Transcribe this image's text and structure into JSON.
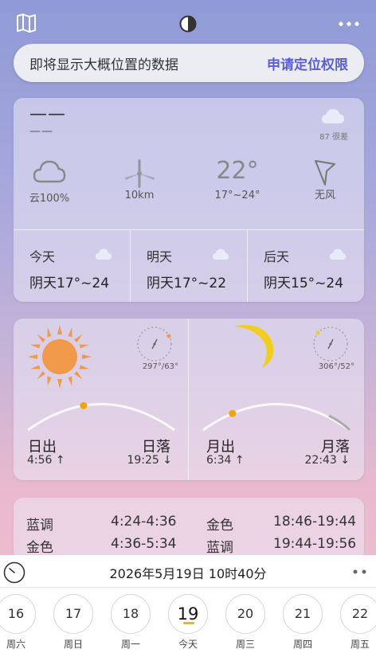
{
  "location_banner": {
    "message": "即将显示大概位置的数据",
    "action": "申请定位权限"
  },
  "current": {
    "location": "——",
    "sublocation": "——",
    "aqi_text": "87 很差",
    "cloud_label": "云100%",
    "visibility": "10km",
    "temperature": "22°",
    "temp_range": "17°~24°",
    "wind": "无风"
  },
  "forecast": [
    {
      "day": "今天",
      "desc": "阴天17°~24"
    },
    {
      "day": "明天",
      "desc": "阴天17°~22"
    },
    {
      "day": "后天",
      "desc": "阴天15°~24"
    }
  ],
  "sun": {
    "azimuth": "297°/63°",
    "rise_label": "日出",
    "rise_time": "4:56 ↑",
    "set_label": "日落",
    "set_time": "19:25 ↓",
    "progress": 0.38
  },
  "moon": {
    "azimuth": "306°/52°",
    "rise_label": "月出",
    "rise_time": "6:34 ↑",
    "set_label": "月落",
    "set_time": "22:43 ↓",
    "progress": 0.2
  },
  "twilight": [
    {
      "label": "蓝调",
      "time": "4:24-4:36"
    },
    {
      "label": "金色",
      "time": "4:36-5:34"
    },
    {
      "label": "金色",
      "time": "18:46-19:44"
    },
    {
      "label": "蓝调",
      "time": "19:44-19:56"
    }
  ],
  "bottom_bar": {
    "datetime": "2026年5月19日  10时40分",
    "days": [
      {
        "num": "16",
        "week": "周六"
      },
      {
        "num": "17",
        "week": "周日"
      },
      {
        "num": "18",
        "week": "周一"
      },
      {
        "num": "19",
        "week": "今天"
      },
      {
        "num": "20",
        "week": "周三"
      },
      {
        "num": "21",
        "week": "周四"
      },
      {
        "num": "22",
        "week": "周五"
      }
    ],
    "today_index": 3
  }
}
